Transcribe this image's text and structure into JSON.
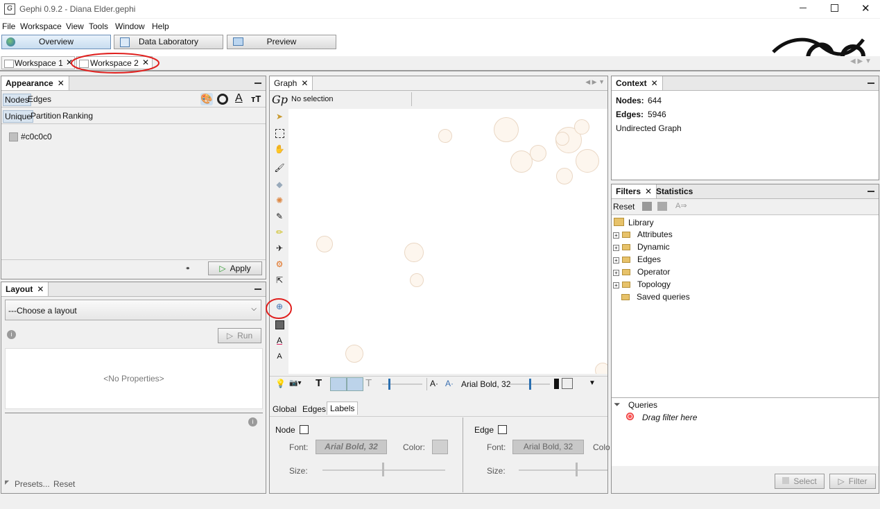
{
  "window": {
    "title": "Gephi 0.9.2 - Diana Elder.gephi",
    "minimize_icon": "minimize-icon",
    "maximize_icon": "maximize-icon",
    "close_icon": "close-icon"
  },
  "menu": [
    "File",
    "Workspace",
    "View",
    "Tools",
    "Window",
    "Help"
  ],
  "modes": {
    "overview": "Overview",
    "data_laboratory": "Data Laboratory",
    "preview": "Preview"
  },
  "workspaces": {
    "tab1": "Workspace 1",
    "tab2": "Workspace 2"
  },
  "appearance": {
    "title": "Appearance",
    "tabs": [
      "Nodes",
      "Edges"
    ],
    "subtabs": [
      "Unique",
      "Partition",
      "Ranking"
    ],
    "color_value": "#c0c0c0",
    "apply": "Apply"
  },
  "layout": {
    "title": "Layout",
    "choose": "---Choose a layout",
    "run": "Run",
    "no_props": "<No Properties>",
    "presets": "Presets...",
    "reset": "Reset"
  },
  "graph": {
    "title": "Graph",
    "selection": "No selection",
    "font_label": "Arial Bold, 32",
    "bottom_tabs": [
      "Global",
      "Edges",
      "Labels"
    ],
    "node_label": "Node",
    "edge_label": "Edge",
    "font": "Font:",
    "color": "Color:",
    "size": "Size:",
    "node_font_value": "Arial Bold, 32",
    "edge_font_value": "Arial Bold, 32",
    "colo_cut": "Colo"
  },
  "context": {
    "title": "Context",
    "nodes_label": "Nodes:",
    "nodes_value": "644",
    "edges_label": "Edges:",
    "edges_value": "5946",
    "graph_type": "Undirected Graph"
  },
  "filters": {
    "tab_filters": "Filters",
    "tab_statistics": "Statistics",
    "reset": "Reset",
    "library": "Library",
    "items": [
      "Attributes",
      "Dynamic",
      "Edges",
      "Operator",
      "Topology",
      "Saved queries"
    ],
    "queries": "Queries",
    "drag": "Drag filter here",
    "select": "Select",
    "filter": "Filter"
  },
  "annotations": {
    "color": "#e0201e"
  }
}
